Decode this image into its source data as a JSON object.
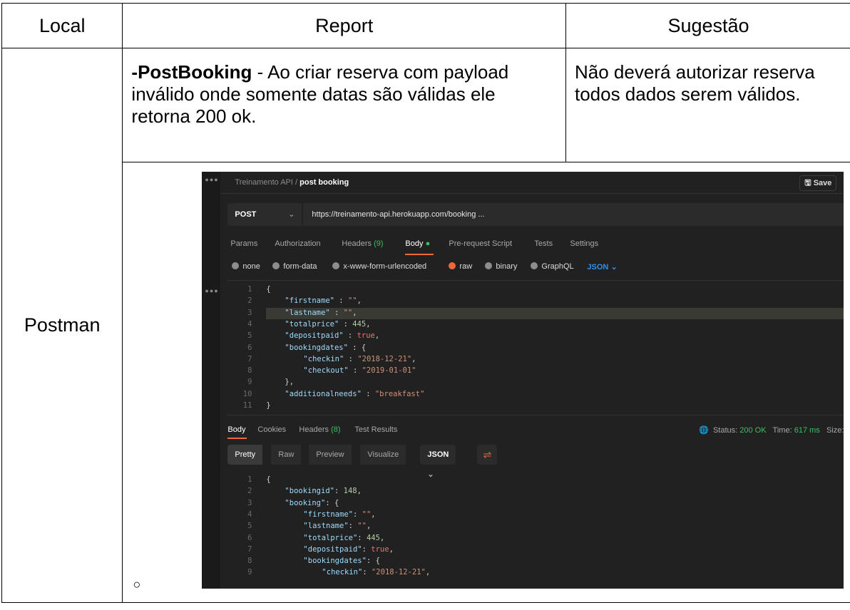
{
  "table": {
    "headers": [
      "Local",
      "Report",
      "Sugestão"
    ],
    "local": "Postman",
    "report_bold": "-PostBooking",
    "report_text": " - Ao criar reserva com payload inválido onde somente datas são válidas ele retorna 200 ok.",
    "suggestion": "Não deverá autorizar reserva todos dados serem válidos.",
    "bullet": "○"
  },
  "postman": {
    "breadcrumb_collection": "Treinamento API",
    "breadcrumb_sep": "/",
    "request_name": "post booking",
    "save_label": "Save",
    "method": "POST",
    "url": "https://treinamento-api.herokuapp.com/booking ...",
    "request_tabs": [
      "Params",
      "Authorization",
      "Headers",
      "Body",
      "Pre-request Script",
      "Tests",
      "Settings"
    ],
    "headers_count": "(9)",
    "body_options": [
      "none",
      "form-data",
      "x-www-form-urlencoded",
      "raw",
      "binary",
      "GraphQL"
    ],
    "body_format": "JSON",
    "request_body": [
      "{",
      "\"firstname\" : \"\",",
      "\"lastname\" : \"\",",
      "\"totalprice\" : 445,",
      "\"depositpaid\" : true,",
      "\"bookingdates\" : {",
      "\"checkin\" : \"2018-12-21\",",
      "\"checkout\" : \"2019-01-01\"",
      "},",
      "\"additionalneeds\" : \"breakfast\"",
      "}"
    ],
    "response_tabs": [
      "Body",
      "Cookies",
      "Headers",
      "Test Results"
    ],
    "response_headers_count": "(8)",
    "status_label": "Status:",
    "status_value": "200 OK",
    "time_label": "Time:",
    "time_value": "617 ms",
    "size_label": "Size:",
    "format_tabs": [
      "Pretty",
      "Raw",
      "Preview",
      "Visualize"
    ],
    "response_format": "JSON",
    "response_body": [
      "{",
      "\"bookingid\": 148,",
      "\"booking\": {",
      "\"firstname\": \"\",",
      "\"lastname\": \"\",",
      "\"totalprice\": 445,",
      "\"depositpaid\": true,",
      "\"bookingdates\": {",
      "\"checkin\": \"2018-12-21\","
    ],
    "colors": {
      "accent": "#f0683a",
      "success": "#3cbf63",
      "json_blue": "#2e8ff0",
      "background": "#212121"
    },
    "icons": [
      "save-icon",
      "chevron-down-icon",
      "globe-icon",
      "wrap-lines-icon"
    ]
  }
}
